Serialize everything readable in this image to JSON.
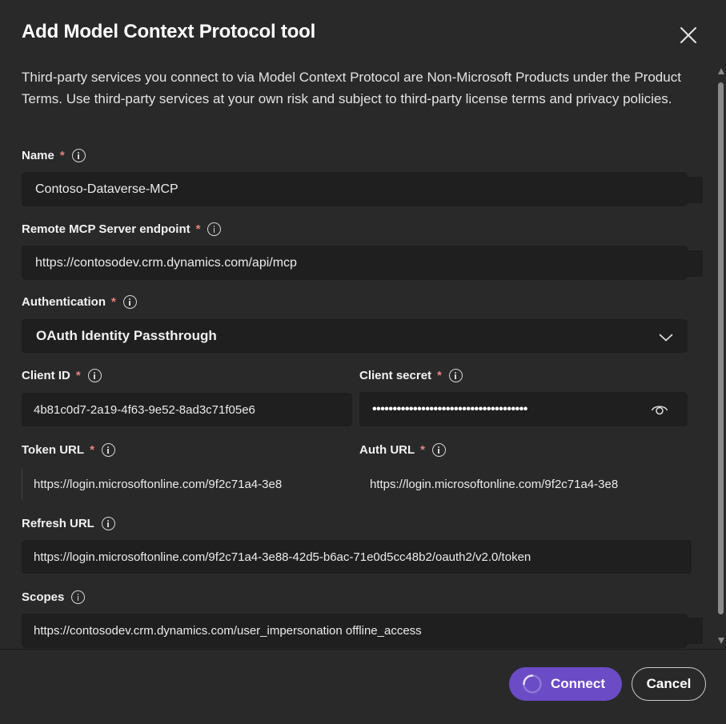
{
  "dialog": {
    "title": "Add Model Context Protocol tool",
    "close_icon": "close-icon",
    "disclaimer": "Third-party services you connect to via Model Context Protocol are Non-Microsoft Products under the Product Terms. Use third-party services at your own risk and subject to third-party license terms and privacy policies."
  },
  "form": {
    "name": {
      "label": "Name",
      "required": "*",
      "value": "Contoso-Dataverse-MCP"
    },
    "endpoint": {
      "label": "Remote MCP Server endpoint",
      "required": "*",
      "value": "https://contosodev.crm.dynamics.com/api/mcp"
    },
    "authentication": {
      "label": "Authentication",
      "required": "*",
      "value": "OAuth Identity Passthrough"
    },
    "client_id": {
      "label": "Client ID",
      "required": "*",
      "value": "4b81c0d7-2a19-4f63-9e52-8ad3c71f05e6"
    },
    "client_secret": {
      "label": "Client secret",
      "required": "*",
      "masked_value": "••••••••••••••••••••••••••••••••••••••"
    },
    "token_url": {
      "label": "Token URL",
      "required": "*",
      "value": "https://login.microsoftonline.com/9f2c71a4-3e8"
    },
    "auth_url": {
      "label": "Auth URL",
      "required": "*",
      "value": "https://login.microsoftonline.com/9f2c71a4-3e8"
    },
    "refresh_url": {
      "label": "Refresh URL",
      "value": "https://login.microsoftonline.com/9f2c71a4-3e88-42d5-b6ac-71e0d5cc48b2/oauth2/v2.0/token"
    },
    "scopes": {
      "label": "Scopes",
      "value": "https://contosodev.crm.dynamics.com/user_impersonation offline_access"
    }
  },
  "footer": {
    "connect_label": "Connect",
    "cancel_label": "Cancel"
  },
  "colors": {
    "background": "#292929",
    "field": "#1f1f1f",
    "accent": "#6b4bc6",
    "required": "#e8837a"
  },
  "icons": [
    "close-icon",
    "info-icon",
    "chevron-down-icon",
    "eye-icon",
    "spinner-icon"
  ]
}
